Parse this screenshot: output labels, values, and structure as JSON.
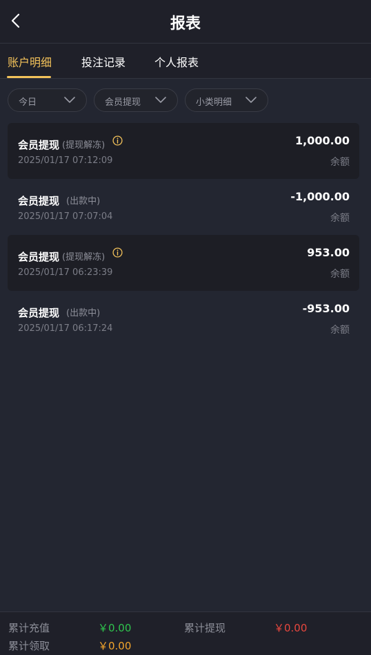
{
  "header": {
    "title": "报表"
  },
  "tabs": [
    {
      "label": "账户明细",
      "active": true
    },
    {
      "label": "投注记录",
      "active": false
    },
    {
      "label": "个人报表",
      "active": false
    }
  ],
  "filters": [
    {
      "label": "今日"
    },
    {
      "label": "会员提现"
    },
    {
      "label": "小类明细"
    }
  ],
  "records": [
    {
      "title": "会员提现",
      "status": "(提现解冻)",
      "has_info": true,
      "time": "2025/01/17 07:12:09",
      "amount": "1,000.00",
      "balance_label": "余额"
    },
    {
      "title": "会员提现",
      "status": "(出款中)",
      "has_info": false,
      "time": "2025/01/17 07:07:04",
      "amount": "-1,000.00",
      "balance_label": "余额"
    },
    {
      "title": "会员提现",
      "status": "(提现解冻)",
      "has_info": true,
      "time": "2025/01/17 06:23:39",
      "amount": "953.00",
      "balance_label": "余额"
    },
    {
      "title": "会员提现",
      "status": "(出款中)",
      "has_info": false,
      "time": "2025/01/17 06:17:24",
      "amount": "-953.00",
      "balance_label": "余额"
    }
  ],
  "footer": {
    "recharge_label": "累计充值",
    "recharge_value": "￥0.00",
    "withdraw_label": "累计提现",
    "withdraw_value": "￥0.00",
    "claim_label": "累计领取",
    "claim_value": "￥0.00"
  },
  "colors": {
    "accent": "#f3c25a",
    "recharge": "#2fc44d",
    "withdraw": "#e8473e",
    "claim": "#f3a52c",
    "info_icon": "#f3c25a"
  }
}
